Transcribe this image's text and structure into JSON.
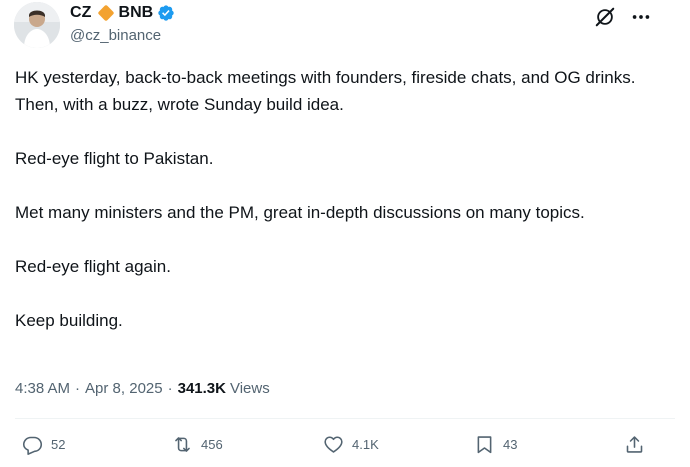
{
  "author": {
    "display_name": "CZ",
    "name_suffix": "BNB",
    "handle": "@cz_binance",
    "diamond_color": "#f3a230",
    "verified_color": "#1d9bf0"
  },
  "header_icons": {
    "grok": "grok-slash-circle-icon",
    "more": "more-dots-icon"
  },
  "tweet": {
    "paragraphs": [
      "HK yesterday, back-to-back meetings with founders, fireside chats, and OG drinks. Then, with a buzz, wrote Sunday build idea.",
      "Red-eye flight to Pakistan.",
      "Met many ministers and the PM, great in-depth discussions on many topics.",
      "Red-eye flight again.",
      "Keep building."
    ]
  },
  "meta": {
    "time": "4:38 AM",
    "separator": "·",
    "date": "Apr 8, 2025",
    "views_count": "341.3K",
    "views_label": "Views"
  },
  "actions": {
    "replies": "52",
    "reposts": "456",
    "likes": "4.1K",
    "bookmarks": "43"
  }
}
